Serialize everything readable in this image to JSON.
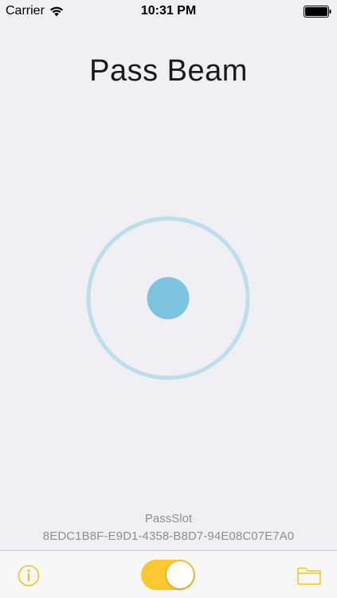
{
  "status_bar": {
    "carrier": "Carrier",
    "time": "10:31 PM",
    "wifi_icon": "wifi-icon",
    "battery_icon": "battery-full-icon"
  },
  "app": {
    "title": "Pass Beam"
  },
  "beacon": {
    "ring_color": "#bcdfeb",
    "dot_color": "#7cc4df"
  },
  "pass": {
    "name": "PassSlot",
    "uuid": "8EDC1B8F-E9D1-4358-B8D7-94E08C07E7A0"
  },
  "toolbar": {
    "info_icon": "info-circle-icon",
    "toggle_on": true,
    "toggle_color": "#fdc72f",
    "folder_icon": "folder-icon",
    "accent_color": "#f5c324"
  }
}
